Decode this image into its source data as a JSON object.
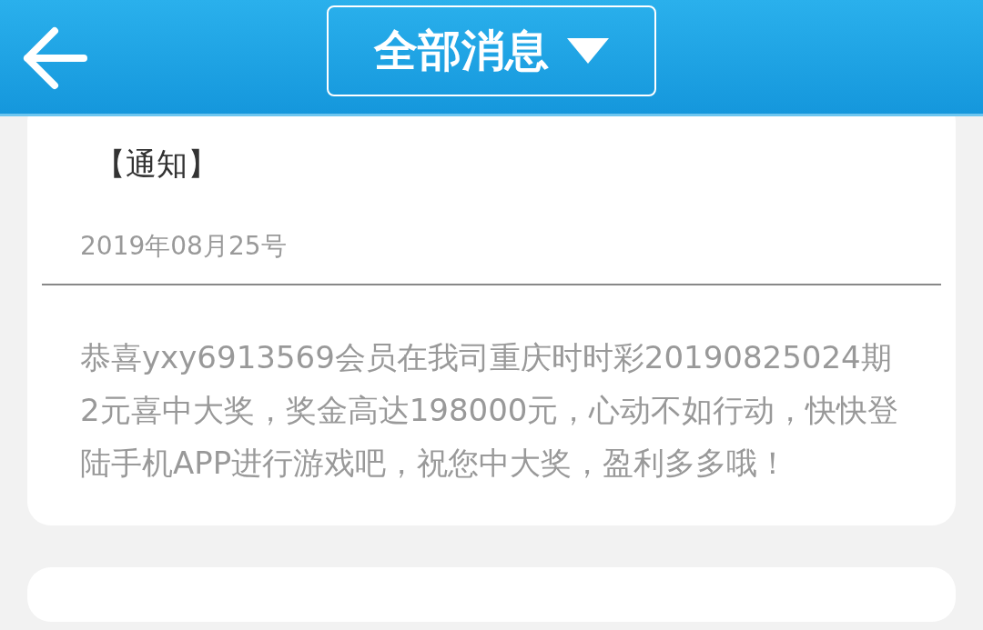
{
  "header": {
    "title": "全部消息"
  },
  "messages": [
    {
      "tag": "【通知】",
      "date": "2019年08月25号",
      "body": "恭喜yxy6913569会员在我司重庆时时彩20190825024期2元喜中大奖，奖金高达198000元，心动不如行动，快快登陆手机APP进行游戏吧，祝您中大奖，盈利多多哦！"
    }
  ]
}
